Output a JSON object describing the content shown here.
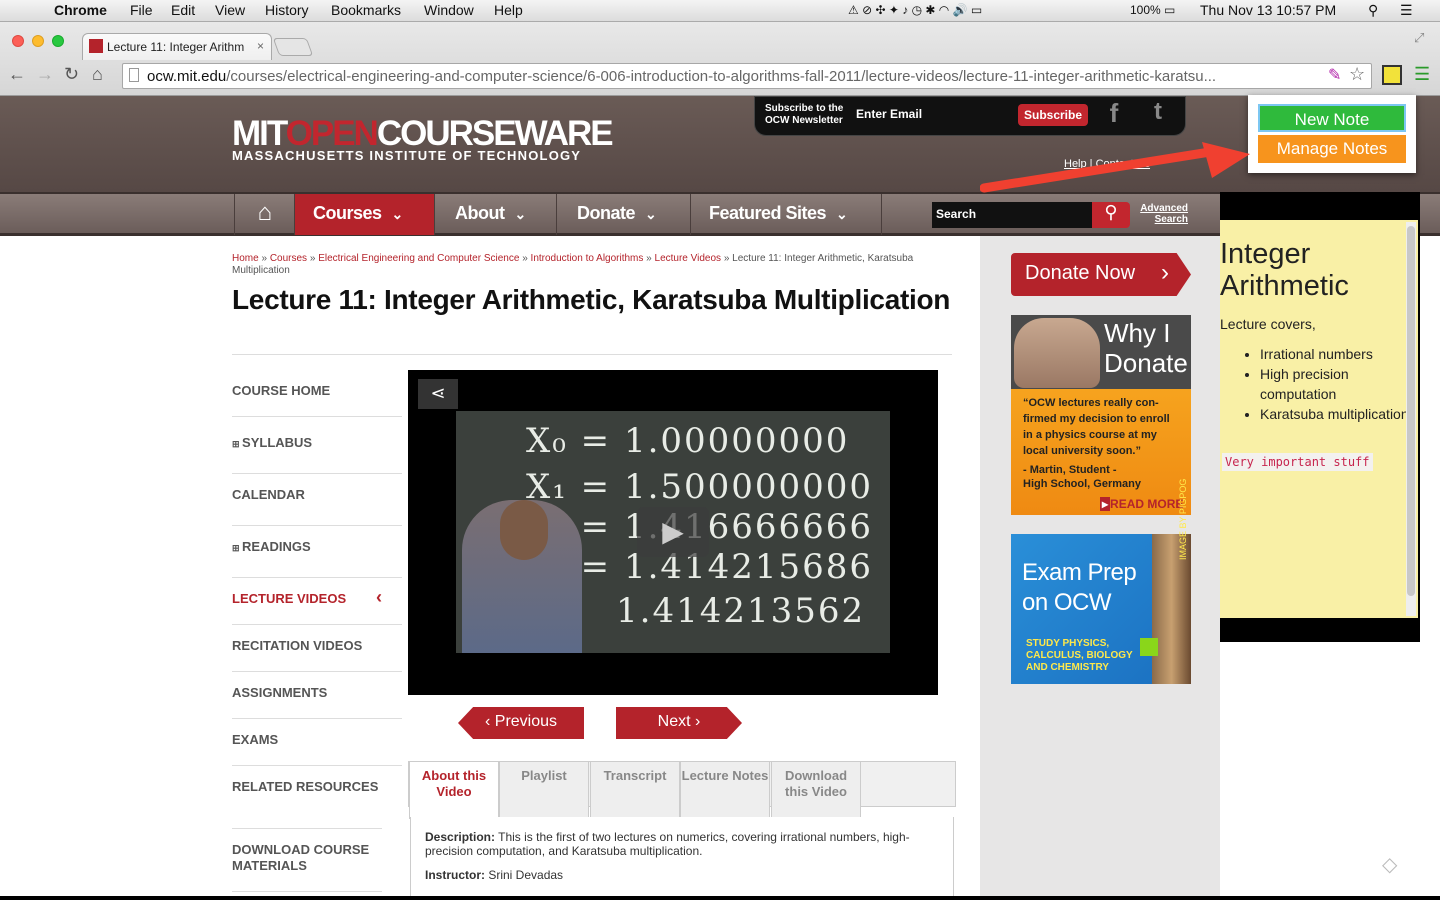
{
  "menubar": {
    "app": "Chrome",
    "items": [
      "File",
      "Edit",
      "View",
      "History",
      "Bookmarks",
      "Window",
      "Help"
    ],
    "battery": "100%",
    "clock": "Thu Nov 13  10:57 PM"
  },
  "browser": {
    "tab_title": "Lecture 11: Integer Arithm",
    "url_host": "ocw.mit.edu",
    "url_path": "/courses/electrical-engineering-and-computer-science/6-006-introduction-to-algorithms-fall-2011/lecture-videos/lecture-11-integer-arithmetic-karatsu..."
  },
  "header": {
    "logo_mit": "MIT",
    "logo_open": "OPEN",
    "logo_cw": "COURSEWARE",
    "logo_sub": "MASSACHUSETTS INSTITUTE OF TECHNOLOGY",
    "subscribe_label": "Subscribe to the OCW Newsletter",
    "email_placeholder": "Enter Email",
    "subscribe_button": "Subscribe",
    "help_links": "Help  |  Contact Us"
  },
  "nav": {
    "courses": "Courses",
    "about": "About",
    "donate": "Donate",
    "featured": "Featured Sites",
    "search_placeholder": "Search",
    "advanced_search": "Advanced Search"
  },
  "breadcrumb": {
    "home": "Home",
    "courses": "Courses",
    "eecs": "Electrical Engineering and Computer Science",
    "course": "Introduction to Algorithms",
    "videos": "Lecture Videos",
    "current": "Lecture 11: Integer Arithmetic, Karatsuba Multiplication"
  },
  "page_title": "Lecture 11: Integer Arithmetic, Karatsuba Multiplication",
  "sidebar": [
    "COURSE HOME",
    "SYLLABUS",
    "CALENDAR",
    "READINGS",
    "LECTURE VIDEOS",
    "RECITATION VIDEOS",
    "ASSIGNMENTS",
    "EXAMS",
    "RELATED RESOURCES",
    "DOWNLOAD COURSE MATERIALS"
  ],
  "video": {
    "board": [
      "X₀ = 1.00000000",
      "X₁ = 1.500000000",
      "X₂ = 1.416666666",
      "X₃ = 1.414215686",
      "1.414213562"
    ]
  },
  "pager": {
    "previous": "Previous",
    "next": "Next"
  },
  "tabs": [
    "About this Video",
    "Playlist",
    "Transcript",
    "Lecture Notes",
    "Download this Video"
  ],
  "description": {
    "label": "Description:",
    "text": "This is the first of two lectures on numerics, covering irrational numbers, high-precision computation, and Karatsuba multiplication.",
    "instructor_label": "Instructor:",
    "instructor": "Srini Devadas"
  },
  "promo": {
    "donate_now": "Donate Now",
    "why_donate": "Why I Donate",
    "quote": "“OCW lectures really con-firmed my decision to enroll in a physics course at my local university soon.”",
    "quote_author": "- Martin, Student - High School, Germany",
    "read_more": "READ MORE",
    "exam_title": "Exam Prep on OCW",
    "exam_sub": "STUDY PHYSICS, CALCULUS, BIOLOGY AND CHEMISTRY",
    "image_credit": "IMAGE BY PIGPOG"
  },
  "note": {
    "title": "Integer Arithmetic",
    "intro": "Lecture covers,",
    "items": [
      "Irrational numbers",
      "High precision computation",
      "Karatsuba multiplication"
    ],
    "code": "Very important stuff"
  },
  "popup": {
    "new_note": "New Note",
    "manage_notes": "Manage Notes"
  },
  "colors": {
    "ocw_red": "#b4232b",
    "new_note_green": "#2fba3c",
    "manage_orange": "#f7941d",
    "note_yellow": "#f9f0a6"
  }
}
